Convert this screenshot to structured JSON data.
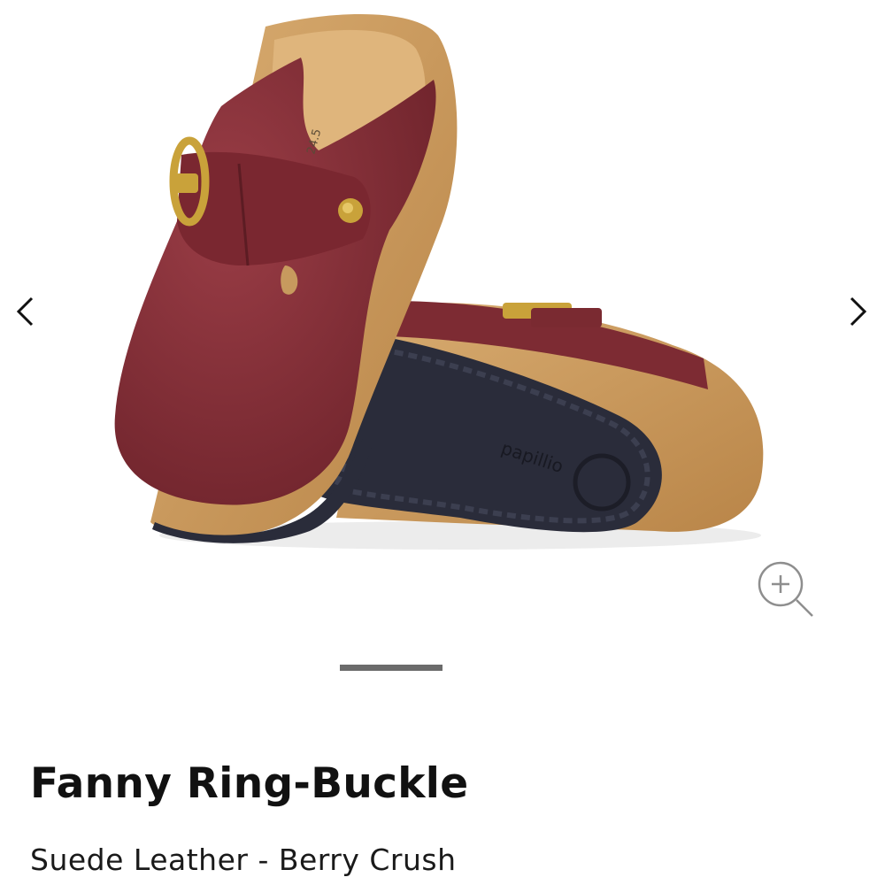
{
  "product": {
    "title": "Fanny Ring-Buckle",
    "subtitle": "Suede Leather - Berry Crush"
  },
  "gallery": {
    "prev_icon": "chevron-left-icon",
    "next_icon": "chevron-right-icon",
    "zoom_icon": "zoom-in-icon",
    "brand_mark": "papillio"
  },
  "colors": {
    "suede": "#7d2b33",
    "cork": "#c79a5e",
    "sole": "#2a2c3a",
    "buckle": "#c9a23a",
    "pager": "#6b6b6b"
  }
}
